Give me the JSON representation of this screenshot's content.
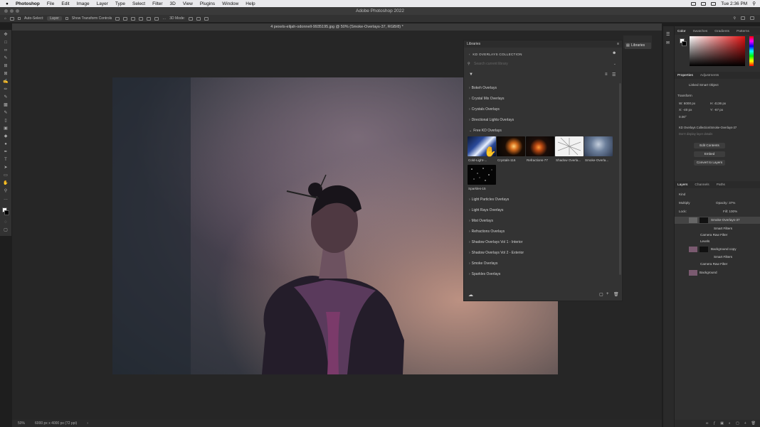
{
  "menubar": {
    "app": "Photoshop",
    "items": [
      "File",
      "Edit",
      "Image",
      "Layer",
      "Type",
      "Select",
      "Filter",
      "3D",
      "View",
      "Plugins",
      "Window",
      "Help"
    ],
    "clock": "Tue 2:36 PM"
  },
  "window": {
    "title": "Adobe Photoshop 2022"
  },
  "options": {
    "auto_select": "Auto-Select:",
    "layer_select": "Layer",
    "transform": "Show Transform Controls",
    "mode": "3D Mode:"
  },
  "document": {
    "tab": "4 pexels-elijah-odonnell-9935195.jpg @ 50% (Smoke-Overlays-37, RGB/8) *",
    "zoom": "50%",
    "size": "6000 px x 4000 px (72 ppi)"
  },
  "libraries": {
    "tab": "Libraries",
    "collection": "KD OVERLAYS COLLECTION",
    "search_placeholder": "Search current library",
    "groups_before": [
      "Bokeh Overlays",
      "Crystal Mix Overlays",
      "Crystals Overlays",
      "Directional Lights Overlays"
    ],
    "open_group": "Free KD Overlays",
    "thumbnails": [
      {
        "label": "Cold-Light-..."
      },
      {
        "label": "Crystals-116"
      },
      {
        "label": "Refractions-77"
      },
      {
        "label": "Shadow Overla..."
      },
      {
        "label": "Smoke-Overla..."
      },
      {
        "label": "Sparkles-15"
      }
    ],
    "groups_after": [
      "Light Particles Overlays",
      "Light Rays Overlays",
      "Mist Overlays",
      "Refractions Overlays",
      "Shadow Overlays Vol 1 - Interior",
      "Shadow Overlays Vol 2 - Exterior",
      "Smoke Overlays",
      "Sparkles Overlays"
    ],
    "dock_label": "Libraries"
  },
  "color_panel": {
    "tabs": [
      "Color",
      "Swatches",
      "Gradients",
      "Patterns"
    ]
  },
  "properties": {
    "tabs": [
      "Properties",
      "Adjustments"
    ],
    "kind": "Linked Smart Object",
    "transform": "Transform",
    "w": "W: 6000 px",
    "h": "H: 4136 px",
    "x": "X: -40 px",
    "y": "Y: -67 px",
    "angle": "0.00°",
    "linked": "KD Overlays Collection/Smoke-Overlays-37",
    "note_placeholder": "Don't display layer details",
    "buttons": [
      "Edit Contents",
      "Embed",
      "Convert to Layers"
    ]
  },
  "layers": {
    "tabs": [
      "Layers",
      "Channels",
      "Paths"
    ],
    "kind": "Kind",
    "blend": "Multiply",
    "opacity": "Opacity: 37%",
    "lock": "Lock:",
    "fill": "Fill: 100%",
    "rows": [
      "Smoke-Overlays-37",
      "Smart Filters",
      "Camera Raw Filter",
      "Levels",
      "Background copy",
      "Smart Filters",
      "Camera Raw Filter",
      "Background"
    ]
  },
  "colors": {
    "accent": "#3b82f6",
    "panel": "#323232"
  }
}
